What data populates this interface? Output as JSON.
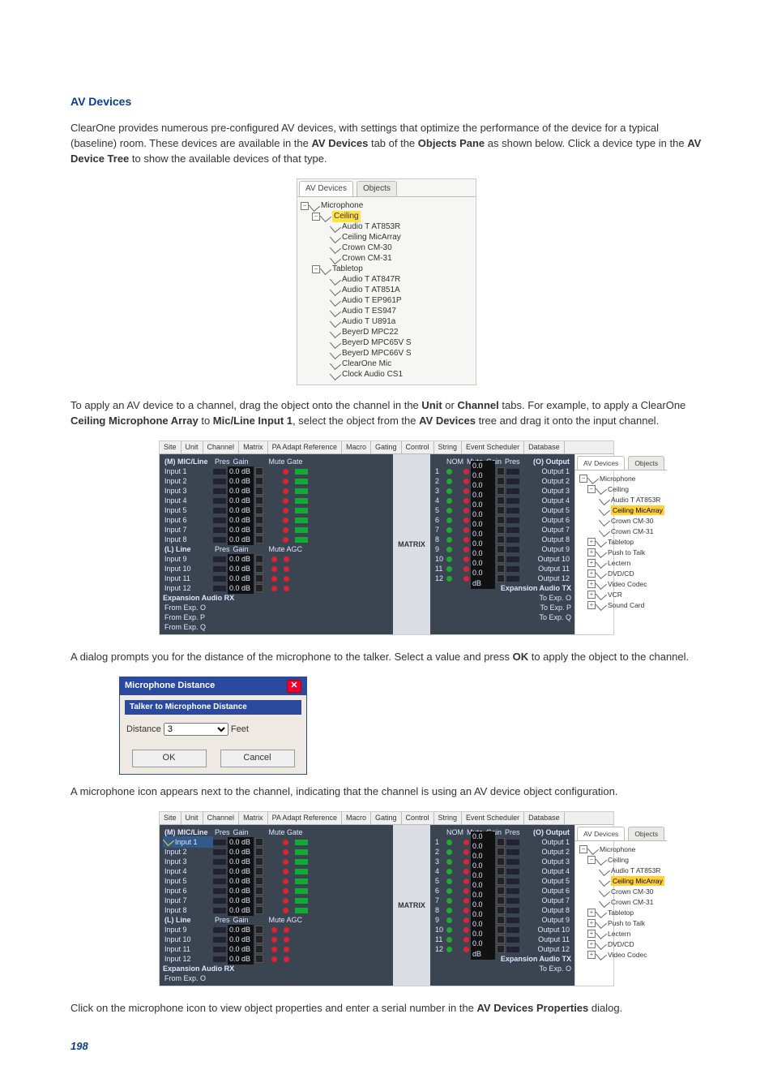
{
  "heading": "AV Devices",
  "para1_a": "ClearOne provides numerous pre-configured AV devices, with settings that optimize the performance of the device for a typical (baseline) room. These devices are available in the ",
  "bold1": "AV Devices",
  "para1_b": " tab of the ",
  "bold2": "Objects Pane",
  "para1_c": " as shown below. Click a device type in the ",
  "bold3": "AV Device Tree",
  "para1_d": " to show the available devices of that type.",
  "tree": {
    "tab_av": "AV Devices",
    "tab_obj": "Objects",
    "root": "Microphone",
    "ceiling": "Ceiling",
    "ceiling_items": [
      "Audio T AT853R",
      "Ceiling MicArray",
      "Crown CM-30",
      "Crown CM-31"
    ],
    "tabletop": "Tabletop",
    "tabletop_items": [
      "Audio T AT847R",
      "Audio T AT851A",
      "Audio T EP961P",
      "Audio T ES947",
      "Audio T U891a",
      "BeyerD MPC22",
      "BeyerD MPC65V S",
      "BeyerD MPC66V S",
      "ClearOne Mic",
      "Clock Audio CS1"
    ]
  },
  "para2_a": "To apply an AV device to a channel, drag the object onto the channel in the ",
  "bold4": "Unit",
  "para2_b": " or ",
  "bold5": "Channel",
  "para2_c": " tabs. For example, to apply a ClearOne ",
  "bold6": "Ceiling Microphone Array",
  "para2_d": " to ",
  "bold7": "Mic/Line Input 1",
  "para2_e": ", select the object from the ",
  "bold8": "AV Devices",
  "para2_f": " tree and drag it onto the input channel.",
  "shot1": {
    "tabs": [
      "Site",
      "Unit",
      "Channel",
      "Matrix",
      "PA Adapt Reference",
      "Macro",
      "Gating",
      "Control",
      "String",
      "Event Scheduler",
      "Database"
    ],
    "lcol_header_left": "(M) MIC/Line",
    "lcol_sub": [
      "Pres",
      "Gain",
      "Mute Gate"
    ],
    "mic_rows": [
      "Input 1",
      "Input 2",
      "Input 3",
      "Input 4",
      "Input 5",
      "Input 6",
      "Input 7",
      "Input 8"
    ],
    "line_header": "(L) Line",
    "line_sub": [
      "Pres",
      "Gain",
      "Mute AGC"
    ],
    "line_rows": [
      "Input 9",
      "Input 10",
      "Input 11",
      "Input 12"
    ],
    "exp_rx": "Expansion Audio RX",
    "exp_rows": [
      "From Exp. O",
      "From Exp. P",
      "From Exp. Q"
    ],
    "matrix": "MATRIX",
    "mid_header": [
      "NOM",
      "Mute",
      "Gain",
      "Pres"
    ],
    "out_header": "(O) Output",
    "out_rows": [
      "Output 1",
      "Output 2",
      "Output 3",
      "Output 4",
      "Output 5",
      "Output 6",
      "Output 7",
      "Output 8",
      "Output 9",
      "Output 10",
      "Output 11",
      "Output 12"
    ],
    "exp_tx": "Expansion Audio TX",
    "exp_tx_rows": [
      "To Exp. O",
      "To Exp. P",
      "To Exp. Q"
    ],
    "right_tree_root": "Microphone",
    "right_ceiling": "Ceiling",
    "right_ceiling_items": [
      "Audio T AT853R",
      "Ceiling MicArray",
      "Crown CM-30",
      "Crown CM-31"
    ],
    "right_groups": [
      "Tabletop",
      "Push to Talk",
      "Lectern",
      "DVD/CD",
      "Video Codec",
      "VCR",
      "Sound Card"
    ]
  },
  "para3_a": "A dialog prompts you for the distance of the microphone to the talker. Select a value and press ",
  "bold9": "OK",
  "para3_b": " to apply the object to the channel.",
  "dlg": {
    "title": "Microphone Distance",
    "subtitle": "Talker to Microphone Distance",
    "label": "Distance",
    "value": "3",
    "unit": "Feet",
    "ok": "OK",
    "cancel": "Cancel"
  },
  "para4": "A microphone icon appears next to the channel, indicating that the channel is using an AV device object configuration.",
  "para5_a": "Click on the microphone icon to view object properties and enter a serial number in the ",
  "bold10": "AV Devices Properties",
  "para5_b": " dialog.",
  "pagenum": "198"
}
